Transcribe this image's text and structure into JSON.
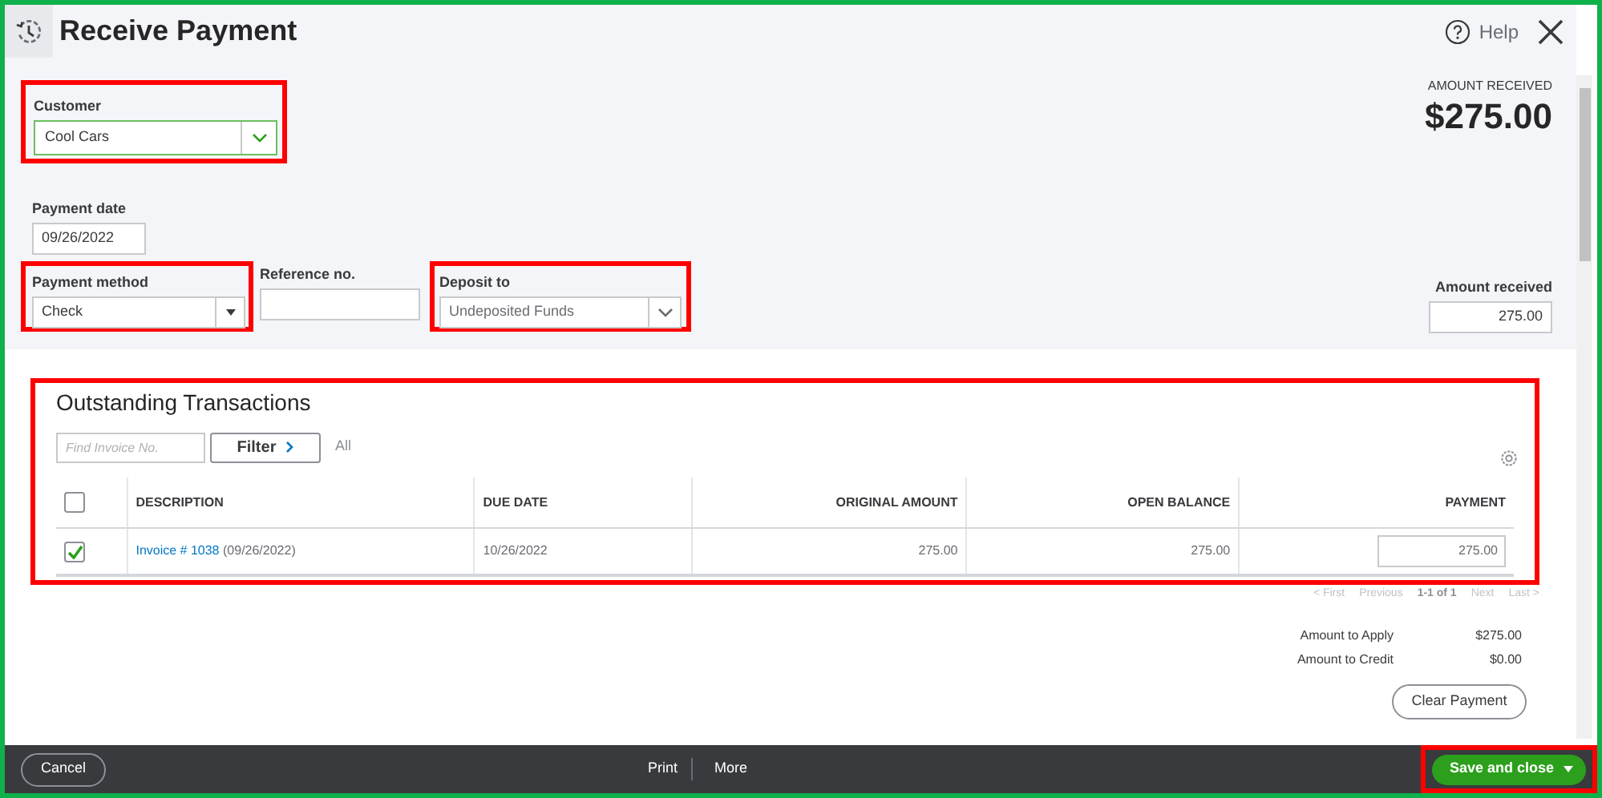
{
  "window": {
    "title": "Receive Payment",
    "help": "Help"
  },
  "amount_header": {
    "label": "AMOUNT RECEIVED",
    "value": "$275.00"
  },
  "customer": {
    "label": "Customer",
    "value": "Cool Cars"
  },
  "payment_date": {
    "label": "Payment date",
    "value": "09/26/2022"
  },
  "payment_method": {
    "label": "Payment method",
    "value": "Check"
  },
  "reference": {
    "label": "Reference no."
  },
  "deposit_to": {
    "label": "Deposit to",
    "value": "Undeposited Funds"
  },
  "amount_received": {
    "label": "Amount received",
    "value": "275.00"
  },
  "outstanding": {
    "title": "Outstanding Transactions",
    "search_placeholder": "Find Invoice No.",
    "filter_button": "Filter",
    "filter_value": "All",
    "header_checked": false,
    "columns": [
      "DESCRIPTION",
      "DUE DATE",
      "ORIGINAL AMOUNT",
      "OPEN BALANCE",
      "PAYMENT"
    ],
    "rows": [
      {
        "checked": true,
        "invoice": "Invoice # 1038",
        "invoice_date": "(09/26/2022)",
        "due_date": "10/26/2022",
        "original_amount": "275.00",
        "open_balance": "275.00",
        "payment": "275.00"
      }
    ]
  },
  "pagination": [
    {
      "kind": "link",
      "label": "< First",
      "disabled": true
    },
    {
      "kind": "link",
      "label": "Previous",
      "disabled": true
    },
    {
      "kind": "range",
      "label": "1-1 of 1"
    },
    {
      "kind": "link",
      "label": "Next",
      "disabled": true
    },
    {
      "kind": "link",
      "label": "Last >",
      "disabled": true
    }
  ],
  "totals": [
    {
      "label": "Amount to Apply",
      "value": "$275.00"
    },
    {
      "label": "Amount to Credit",
      "value": "$0.00"
    }
  ],
  "clear_button": "Clear Payment",
  "footer": {
    "cancel": "Cancel",
    "print": "Print",
    "more": "More",
    "save": "Save and close"
  }
}
